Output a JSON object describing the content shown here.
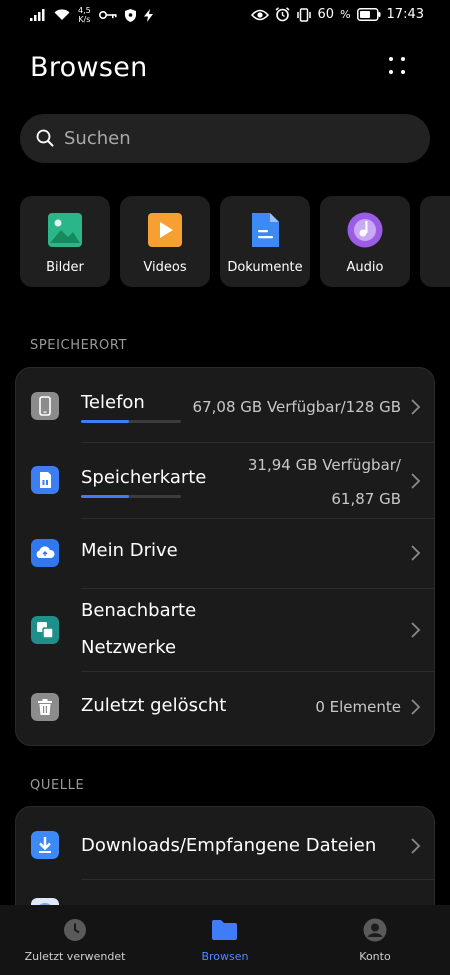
{
  "status_bar": {
    "speed_value": "4,5",
    "speed_unit": "K/s",
    "battery_text": "60",
    "percent_sign": "%",
    "time": "17:43"
  },
  "header": {
    "title": "Browsen"
  },
  "search": {
    "placeholder": "Suchen"
  },
  "categories": [
    {
      "label": "Bilder",
      "icon": "image-icon",
      "color": "#2bb68a"
    },
    {
      "label": "Videos",
      "icon": "video-icon",
      "color": "#f5a031"
    },
    {
      "label": "Dokumente",
      "icon": "document-icon",
      "color": "#3d8af7"
    },
    {
      "label": "Audio",
      "icon": "audio-icon",
      "color": "#9b5de5"
    }
  ],
  "storage": {
    "section_title": "SPEICHERORT",
    "items": [
      {
        "label": "Telefon",
        "info": "67,08 GB Verfügbar/128 GB",
        "progress": 0.48,
        "icon": "phone-icon"
      },
      {
        "label": "Speicherkarte",
        "info_line1": "31,94 GB Verfügbar/",
        "info_line2": "61,87 GB",
        "progress": 0.48,
        "icon": "sd-card-icon"
      },
      {
        "label": "Mein Drive",
        "icon": "cloud-drive-icon"
      },
      {
        "label_line1": "Benachbarte",
        "label_line2": "Netzwerke",
        "icon": "network-icon"
      },
      {
        "label": "Zuletzt gelöscht",
        "info": "0 Elemente",
        "icon": "trash-icon"
      }
    ]
  },
  "source": {
    "section_title": "QUELLE",
    "items": [
      {
        "label": "Downloads/Empfangene Dateien",
        "icon": "download-icon"
      }
    ]
  },
  "bottom_nav": [
    {
      "label": "Zuletzt verwendet",
      "icon": "clock-icon",
      "active": false
    },
    {
      "label": "Browsen",
      "icon": "folder-icon",
      "active": true
    },
    {
      "label": "Konto",
      "icon": "account-icon",
      "active": false
    }
  ],
  "colors": {
    "accent": "#3f7cf7",
    "background": "#000000",
    "card": "#1b1b1b"
  }
}
